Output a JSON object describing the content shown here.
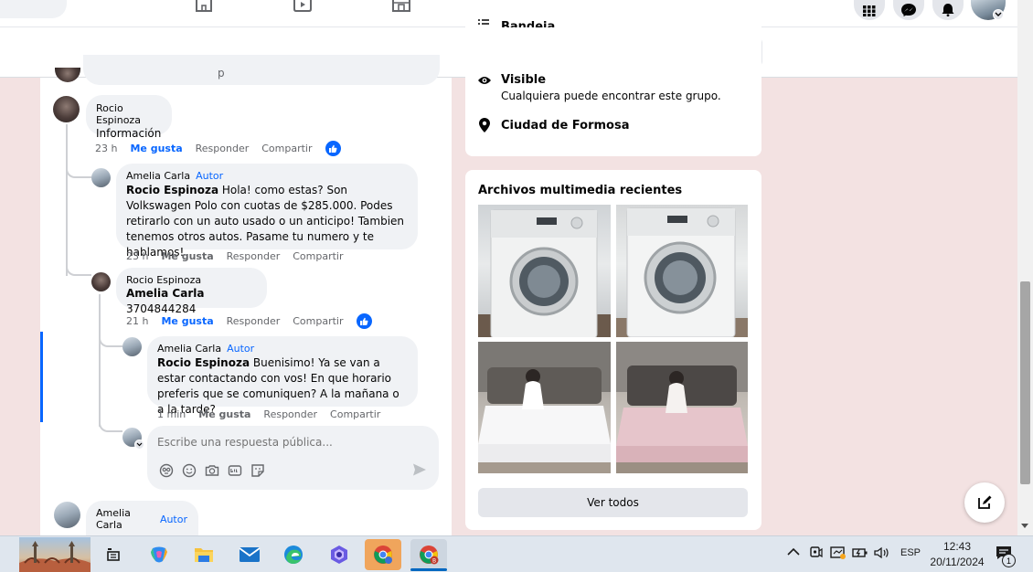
{
  "comments": {
    "top_partial_text": "p",
    "c1": {
      "name": "Rocio Espinoza",
      "text": "Información",
      "time": "23 h",
      "like": "Me gusta",
      "reply": "Responder",
      "share": "Compartir"
    },
    "c2": {
      "name": "Amelia Carla",
      "author": "Autor",
      "mention": "Rocio Espinoza",
      "text": " Hola! como estas? Son Volkswagen Polo con cuotas de $285.000. Podes retirarlo con un auto usado o un anticipo! Tambien tenemos otros autos. Pasame tu numero y te hablamos!",
      "time": "23 h",
      "like": "Me gusta",
      "reply": "Responder",
      "share": "Compartir"
    },
    "c3": {
      "name": "Rocio Espinoza",
      "mention": "Amelia Carla",
      "text": " 3704844284",
      "time": "21 h",
      "like": "Me gusta",
      "reply": "Responder",
      "share": "Compartir"
    },
    "c4": {
      "name": "Amelia Carla",
      "author": "Autor",
      "mention": "Rocio Espinoza",
      "text": " Buenisimo! Ya se van a estar contactando con vos! En que horario preferis que se comuniquen? A la mañana o a la tarde?",
      "time": "1 min",
      "like": "Me gusta",
      "reply": "Responder",
      "share": "Compartir"
    },
    "reply_box": {
      "placeholder": "Escribe una respuesta pública..."
    },
    "c5": {
      "name": "Amelia Carla",
      "author": "Autor",
      "text": "-"
    }
  },
  "group_info": {
    "partial_title": "Bandeja",
    "visible_title": "Visible",
    "visible_desc": "Cualquiera puede encontrar este grupo.",
    "location": "Ciudad de Formosa"
  },
  "media": {
    "title": "Archivos multimedia recientes",
    "see_all": "Ver todos"
  },
  "taskbar": {
    "lang": "ESP",
    "time": "12:43",
    "date": "20/11/2024",
    "notif_count": "1"
  },
  "colors": {
    "accent": "#0866ff",
    "page_bg": "#f3e2e2",
    "bubble": "#f0f2f5"
  }
}
